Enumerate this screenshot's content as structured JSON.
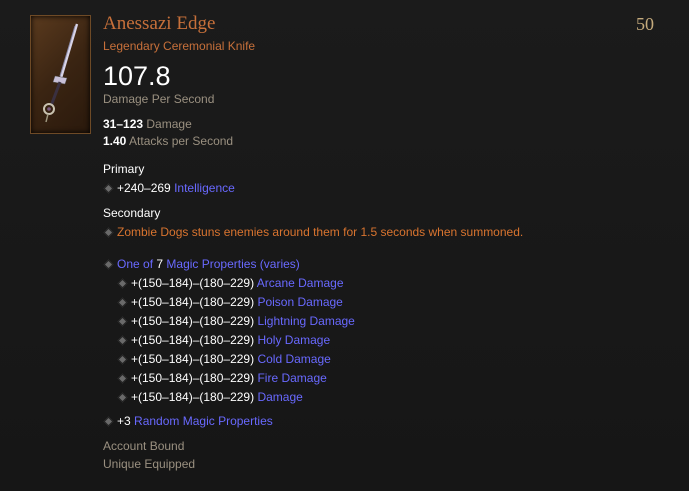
{
  "item": {
    "name": "Anessazi Edge",
    "type": "Legendary Ceremonial Knife",
    "level": "50",
    "dps": "107.8",
    "dps_label": "Damage Per Second",
    "damage_value": "31–123",
    "damage_label": "Damage",
    "aps_value": "1.40",
    "aps_label": "Attacks per Second"
  },
  "primary": {
    "title": "Primary",
    "value": "+240–269",
    "label": "Intelligence"
  },
  "secondary": {
    "title": "Secondary",
    "text": "Zombie Dogs stuns enemies around them for 1.5 seconds when summoned."
  },
  "magic": {
    "prefix": "One of",
    "count": "7",
    "label": "Magic Properties (varies)",
    "options": [
      {
        "value": "+(150–184)–(180–229)",
        "label": "Arcane Damage"
      },
      {
        "value": "+(150–184)–(180–229)",
        "label": "Poison Damage"
      },
      {
        "value": "+(150–184)–(180–229)",
        "label": "Lightning Damage"
      },
      {
        "value": "+(150–184)–(180–229)",
        "label": "Holy Damage"
      },
      {
        "value": "+(150–184)–(180–229)",
        "label": "Cold Damage"
      },
      {
        "value": "+(150–184)–(180–229)",
        "label": "Fire Damage"
      },
      {
        "value": "+(150–184)–(180–229)",
        "label": "Damage"
      }
    ],
    "random_value": "+3",
    "random_label": "Random Magic Properties"
  },
  "footer": {
    "bound": "Account Bound",
    "unique": "Unique Equipped"
  },
  "colors": {
    "legendary": "#c7703a",
    "magic": "#6969ff",
    "white": "#ffffff",
    "muted": "#9a9080",
    "level": "#c4aa7c"
  },
  "icons": {
    "item_icon": "ceremonial-knife-icon",
    "bullet": "diamond-bullet-icon"
  }
}
